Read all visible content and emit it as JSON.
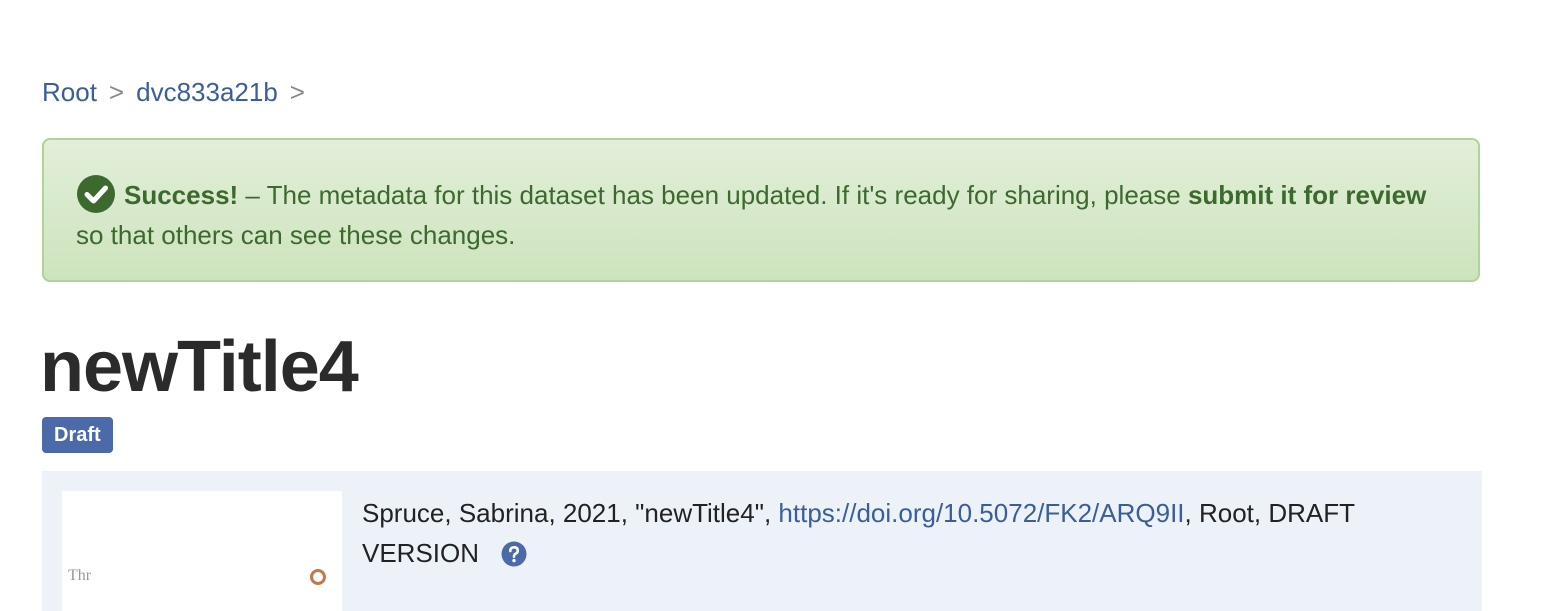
{
  "breadcrumb": {
    "items": [
      "Root",
      "dvc833a21b"
    ],
    "separator": ">"
  },
  "alert": {
    "icon": "check-circle-icon",
    "title": "Success!",
    "text_before": " – The metadata for this dataset has been updated. If it's ready for sharing, please ",
    "link_text": "submit it for review",
    "text_after": " so that others can see these changes.",
    "color": "#3c6a2e"
  },
  "dataset": {
    "title": "newTitle4",
    "status_badge": "Draft"
  },
  "citation": {
    "text_before": "Spruce, Sabrina, 2021, \"newTitle4\", ",
    "doi": "https://doi.org/10.5072/FK2/ARQ9II",
    "text_after": ", Root, DRAFT VERSION",
    "help_icon": "question-circle-icon"
  },
  "thumbnail": {
    "partial_text": "Thr"
  }
}
